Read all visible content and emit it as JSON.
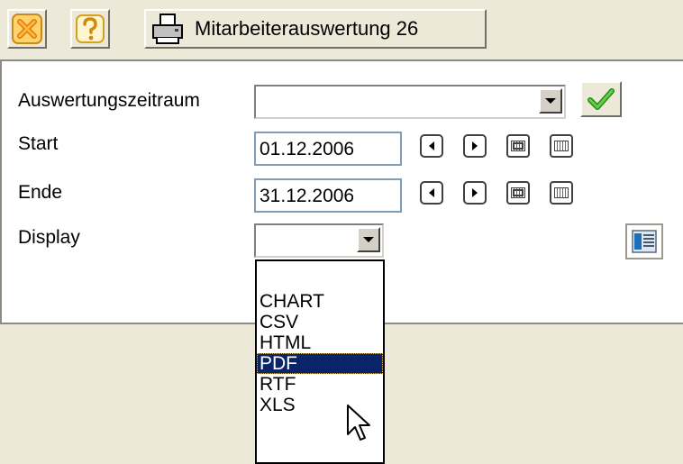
{
  "toolbar": {
    "close_icon": "close-x-icon",
    "help_icon": "help-question-icon",
    "print_icon": "printer-icon",
    "title": "Mitarbeiterauswertung 26"
  },
  "form": {
    "period": {
      "label": "Auswertungszeitraum",
      "value": ""
    },
    "start": {
      "label": "Start",
      "value": "01.12.2006"
    },
    "end": {
      "label": "Ende",
      "value": "31.12.2006"
    },
    "display": {
      "label": "Display",
      "value": "",
      "options": [
        "",
        "CHART",
        "CSV",
        "HTML",
        "PDF",
        "RTF",
        "XLS"
      ],
      "highlighted": "PDF"
    }
  },
  "colors": {
    "selection": "#0a246a",
    "textbox_border": "#7f9db9",
    "check_green": "#34b11e",
    "close_orange": "#f29a26"
  }
}
